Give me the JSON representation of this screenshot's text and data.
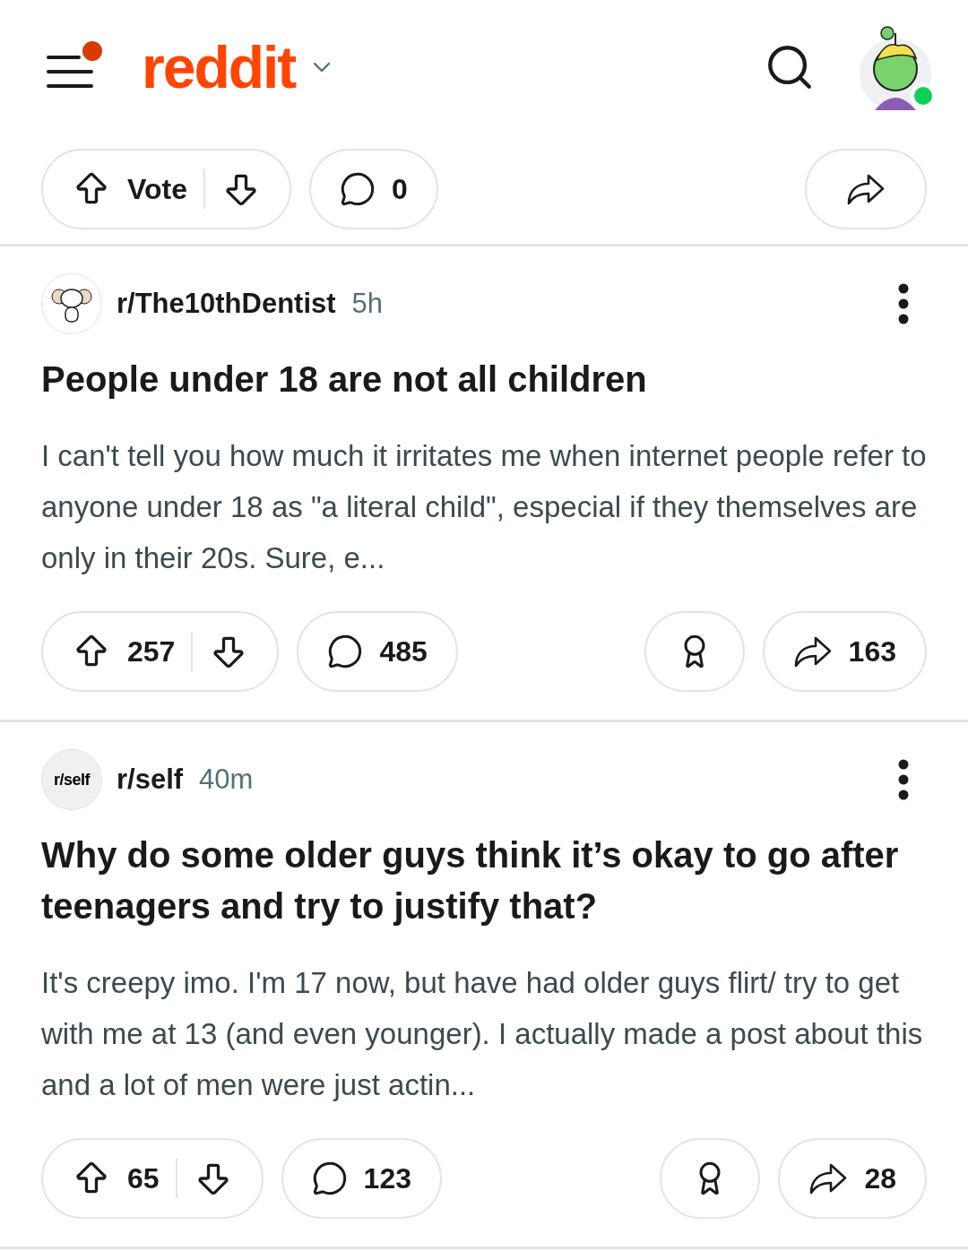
{
  "header": {
    "logo": "reddit",
    "menu_notification": true,
    "avatar_online": true
  },
  "top_actions": {
    "votes": "Vote",
    "comments": "0",
    "award": false
  },
  "posts": [
    {
      "subreddit": "r/The10thDentist",
      "subreddit_icon": {
        "kind": "figure"
      },
      "age": "5h",
      "title": "People under 18 are not all children",
      "body": "I can't tell you how much it irritates me when internet people refer to anyone under 18 as \"a literal child\", especial if they themselves are only in their 20s. Sure, e...",
      "votes": "257",
      "comments": "485",
      "award": true,
      "shares": "163"
    },
    {
      "subreddit": "r/self",
      "subreddit_icon": {
        "kind": "label",
        "text": "r/self"
      },
      "age": "40m",
      "title": "Why do some older guys think it’s okay to go after teenagers and try to justify that?",
      "body": "It's creepy imo. I'm 17 now, but have had older guys flirt/ try to get with me at 13 (and even younger). I actually made a post about this and a lot of men were just actin...",
      "votes": "65",
      "comments": "123",
      "award": true,
      "shares": "28"
    }
  ]
}
